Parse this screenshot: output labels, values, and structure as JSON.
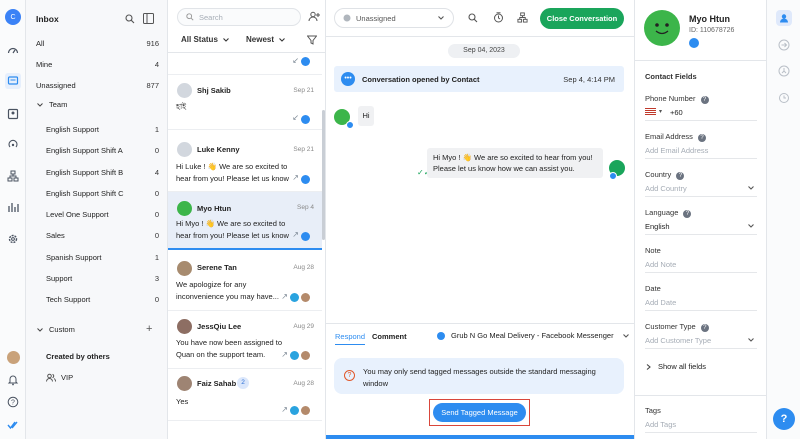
{
  "user_initial": "C",
  "inbox": {
    "title": "Inbox",
    "items": [
      {
        "label": "All",
        "count": "916"
      },
      {
        "label": "Mine",
        "count": "4"
      },
      {
        "label": "Unassigned",
        "count": "877"
      }
    ],
    "team_header": "Team",
    "teams": [
      {
        "label": "English Support",
        "count": "1"
      },
      {
        "label": "English Support Shift A",
        "count": "0"
      },
      {
        "label": "English Support Shift B",
        "count": "4"
      },
      {
        "label": "English Support Shift C",
        "count": "0"
      },
      {
        "label": "Level One Support",
        "count": "0"
      },
      {
        "label": "Sales",
        "count": "0"
      },
      {
        "label": "Spanish Support",
        "count": "1"
      },
      {
        "label": "Support",
        "count": "3"
      },
      {
        "label": "Tech Support",
        "count": "0"
      }
    ],
    "custom_header": "Custom",
    "created_header": "Created by others",
    "vip": "VIP"
  },
  "convlist": {
    "search_placeholder": "Search",
    "filter_status": "All Status",
    "sort": "Newest",
    "conversations": [
      {
        "name": "Shj Sakib",
        "time": "Sep 21",
        "msg": "হাই"
      },
      {
        "name": "Luke Kenny",
        "time": "Sep 21",
        "msg": "Hi Luke ! 👋 We are so excited to hear from you! Please let us know"
      },
      {
        "name": "Myo Htun",
        "time": "Sep 4",
        "msg": "Hi Myo ! 👋 We are so excited to hear from you! Please let us know"
      },
      {
        "name": "Serene Tan",
        "time": "Aug 28",
        "msg": "We apologize for any inconvenience you may have..."
      },
      {
        "name": "JessQiu Lee",
        "time": "Aug 29",
        "msg": "You have now been assigned to Quan on the support team."
      },
      {
        "name": "Faiz Sahab",
        "time": "Aug 28",
        "msg": "Yes",
        "badge": "2"
      }
    ]
  },
  "main": {
    "assignee": "Unassigned",
    "close_button": "Close Conversation",
    "date": "Sep 04, 2023",
    "event_text": "Conversation opened by Contact",
    "event_time": "Sep 4, 4:14 PM",
    "incoming_msg": "Hi",
    "outgoing_msg": "Hi Myo ! 👋 We are so excited to hear from you! Please let us know how we can assist you.",
    "tab_respond": "Respond",
    "tab_comment": "Comment",
    "channel": "Grub N Go Meal Delivery - Facebook Messenger",
    "warning": "You may only send tagged messages outside the standard messaging window",
    "send_tagged": "Send Tagged Message"
  },
  "contact": {
    "name": "Myo Htun",
    "id": "ID: 110678726",
    "fields_title": "Contact Fields",
    "phone_label": "Phone Number",
    "phone_value": "+60",
    "email_label": "Email Address",
    "email_ph": "Add Email Address",
    "country_label": "Country",
    "country_ph": "Add Country",
    "language_label": "Language",
    "language_value": "English",
    "note_label": "Note",
    "note_ph": "Add Note",
    "date_label": "Date",
    "date_ph": "Add Date",
    "ctype_label": "Customer Type",
    "ctype_ph": "Add Customer Type",
    "show_all": "Show all fields",
    "tags_label": "Tags",
    "tags_ph": "Add Tags"
  },
  "help_label": "?",
  "colors": {
    "brand_green": "#1aa55b",
    "accent_blue": "#2d8cf0",
    "selected_row": "#e8eef8"
  }
}
